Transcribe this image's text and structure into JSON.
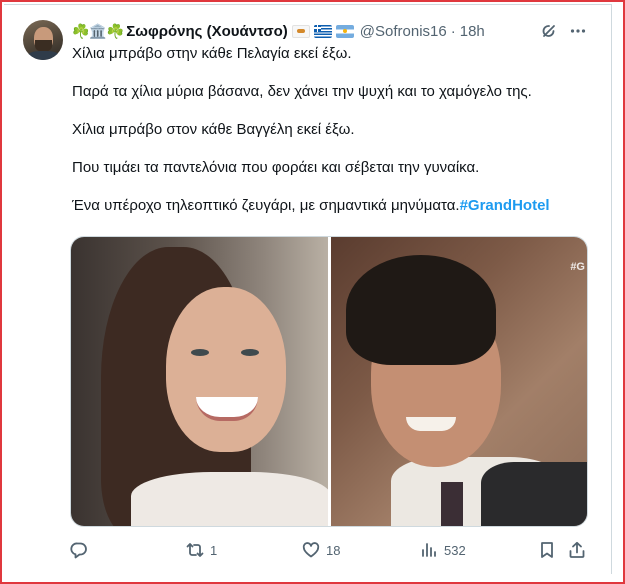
{
  "tweet": {
    "author": {
      "name_prefix_emoji": "☘️🏛️☘️",
      "name": "Σωφρόνης (Χουάντσο)",
      "flags": [
        "cyprus-flag",
        "greece-flag",
        "argentina-flag"
      ],
      "handle": "@Sofronis16",
      "separator": "·",
      "time": "18h"
    },
    "text_lines": [
      "Χίλια μπράβο στην κάθε Πελαγία εκεί έξω.",
      "Παρά τα χίλια μύρια βάσανα, δεν χάνει την ψυχή και το χαμόγελο της.",
      "Χίλια μπράβο στον κάθε Βαγγέλη εκεί έξω.",
      "Που τιμάει τα παντελόνια που φοράει και σέβεται την γυναίκα."
    ],
    "last_line": {
      "text": "Ένα υπέροχο τηλεοπτικό ζευγάρι, με σημαντικά μηνύματα.",
      "hashtag": "#GrandHotel"
    },
    "media": {
      "watermark": "#G"
    },
    "actions": {
      "reply": {
        "icon": "reply-icon",
        "count": ""
      },
      "retweet": {
        "icon": "retweet-icon",
        "count": "1"
      },
      "like": {
        "icon": "heart-icon",
        "count": "18"
      },
      "views": {
        "icon": "views-icon",
        "count": "532"
      },
      "bookmark": {
        "icon": "bookmark-icon"
      },
      "share": {
        "icon": "share-icon"
      }
    }
  },
  "colors": {
    "accent": "#1d9bf0",
    "text": "#0f1419",
    "muted": "#536471",
    "frame": "#e0383e"
  }
}
